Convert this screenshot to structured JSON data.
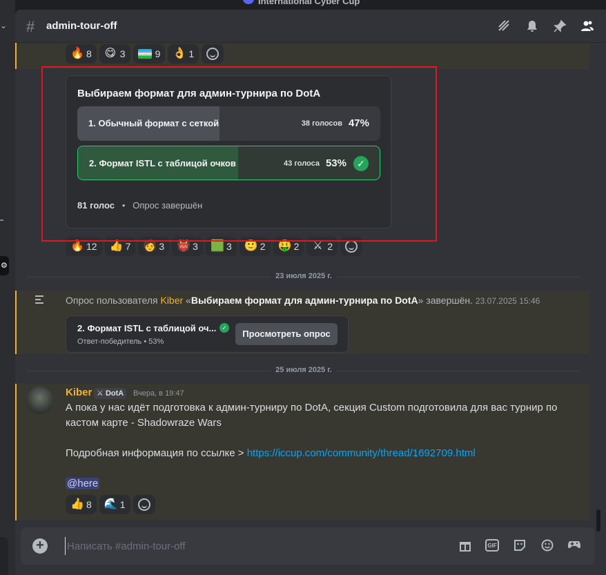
{
  "top_server_name": "International Cyber Cup",
  "header": {
    "channel": "admin-tour-off",
    "icons": [
      "threads-icon",
      "bell-icon",
      "pin-icon",
      "members-icon"
    ]
  },
  "reactions_top": [
    {
      "emoji": "🔥",
      "count": "8"
    },
    {
      "emoji": "😋",
      "count": "3"
    },
    {
      "emoji": "flag-uz",
      "count": "9"
    },
    {
      "emoji": "👌",
      "count": "1"
    }
  ],
  "poll": {
    "question": "Выбираем формат для админ-турнира по DotA",
    "options": [
      {
        "label": "1. Обычный формат с сеткой",
        "votes": "38 голосов",
        "percent": "47%",
        "share": 0.47,
        "winner": false
      },
      {
        "label": "2. Формат ISTL с таблицой очков",
        "votes": "43 голоса",
        "percent": "53%",
        "share": 0.53,
        "winner": true
      }
    ],
    "total": "81 голос",
    "status": "Опрос завершён"
  },
  "reactions_poll": [
    {
      "emoji": "🔥",
      "count": "12"
    },
    {
      "emoji": "👍",
      "count": "7"
    },
    {
      "emoji": "🧑",
      "count": "3"
    },
    {
      "emoji": "👹",
      "count": "3"
    },
    {
      "emoji": "🟩",
      "count": "3"
    },
    {
      "emoji": "🙂",
      "count": "2"
    },
    {
      "emoji": "🤑",
      "count": "2"
    },
    {
      "emoji": "⚔",
      "count": "2"
    }
  ],
  "divider1": "23 июля 2025 г.",
  "system_msg": {
    "prefix": "Опрос пользователя ",
    "user": "Kiber",
    "open_quote": " «",
    "poll_title": "Выбираем формат для админ-турнира по DotA",
    "close": "» завершён.",
    "timestamp": "23.07.2025 15:46"
  },
  "result": {
    "title": "2. Формат ISTL с таблицой оч...",
    "subtitle": "Ответ-победитель • 53%",
    "button": "Просмотреть опрос"
  },
  "divider2": "25 июля 2025 г.",
  "message": {
    "author": "Kiber",
    "tag": "DotA",
    "time": "Вчера, в 19:47",
    "line1": "А пока у нас идёт подготовка к админ-турниру по DotA, секция Custom подготовила для вас турнир по",
    "line2": "кастом карте - Shadowraze Wars",
    "line3_prefix": "Подробная информация по ссылке > ",
    "link": "https://iccup.com/community/thread/1692709.html",
    "mention": "@here"
  },
  "reactions_msg": [
    {
      "emoji": "👍",
      "count": "8"
    },
    {
      "emoji": "🌊",
      "count": "1"
    }
  ],
  "composer": {
    "placeholder": "Написать #admin-tour-off"
  },
  "colors": {
    "accent": "#f0b232",
    "win": "#23a55a",
    "link": "#00a8fc",
    "annotation": "#e0191f"
  }
}
